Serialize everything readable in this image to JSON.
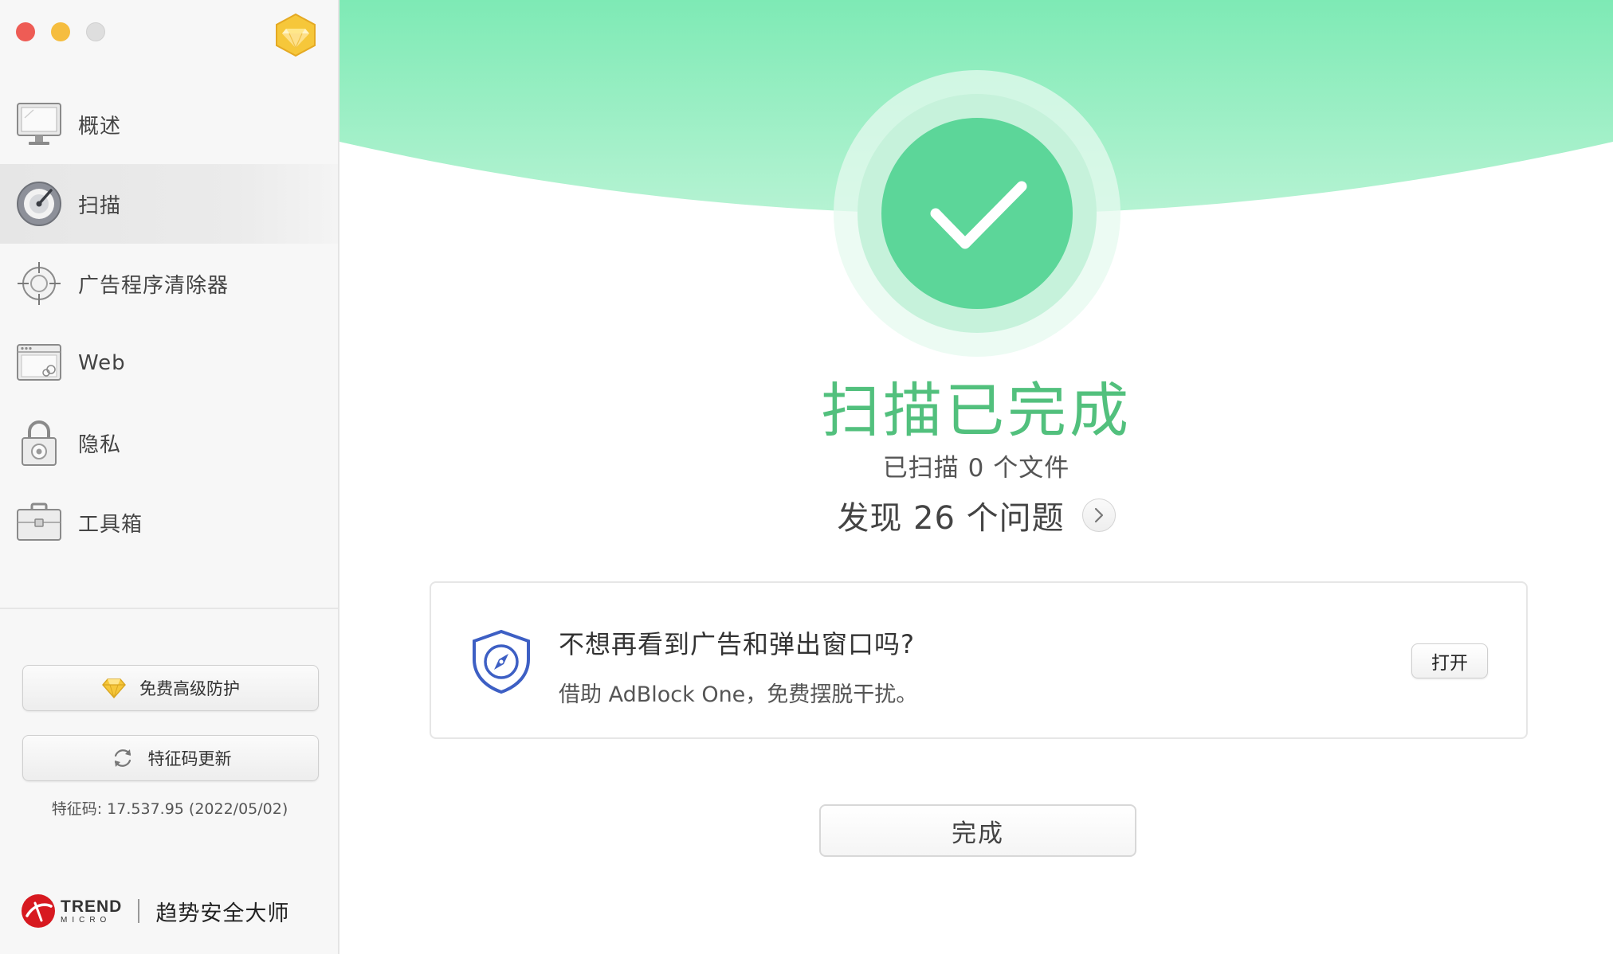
{
  "window": {
    "controls": [
      "close",
      "minimize",
      "zoom"
    ],
    "premium_icon": "gem-icon"
  },
  "sidebar": {
    "items": [
      {
        "label": "概述",
        "icon": "monitor-icon",
        "active": false
      },
      {
        "label": "扫描",
        "icon": "scan-gauge-icon",
        "active": true
      },
      {
        "label": "广告程序清除器",
        "icon": "crosshair-icon",
        "active": false
      },
      {
        "label": "Web",
        "icon": "browser-window-icon",
        "active": false
      },
      {
        "label": "隐私",
        "icon": "padlock-icon",
        "active": false
      },
      {
        "label": "工具箱",
        "icon": "toolbox-icon",
        "active": false
      }
    ],
    "premium_button": "免费高级防护",
    "update_button": "特征码更新",
    "signature_text": "特征码: 17.537.95 (2022/05/02)",
    "brand": {
      "logo_line1": "TREND",
      "logo_line2": "MICRO",
      "product_name": "趋势安全大师"
    }
  },
  "main": {
    "status_icon": "checkmark-icon",
    "title": "扫描已完成",
    "scanned_files": "已扫描 0 个文件",
    "issues_found": "发现 26 个问题",
    "promo": {
      "icon": "shield-compass-icon",
      "title": "不想再看到广告和弹出窗口吗?",
      "description": "借助 AdBlock One，免费摆脱干扰。",
      "open_button": "打开"
    },
    "done_button": "完成"
  },
  "colors": {
    "accent_green": "#52c07d",
    "banner_green": "#86ebb8",
    "check_circle": "#5cd699",
    "promo_blue": "#3d5fc4",
    "premium_gold": "#f2c230"
  }
}
